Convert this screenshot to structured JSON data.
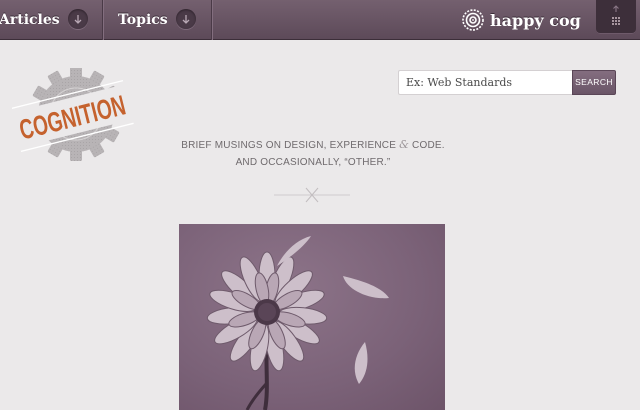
{
  "nav": {
    "items": [
      {
        "label": "Articles",
        "icon": "chevron-down-icon"
      },
      {
        "label": "Topics",
        "icon": "chevron-down-icon"
      }
    ],
    "brand": {
      "name": "happy cog",
      "icon": "happy-cog-spiral-icon"
    },
    "grid_icon": "grid-menu-icon"
  },
  "logo": {
    "text": "COGNITION"
  },
  "search": {
    "placeholder": "Ex: Web Standards",
    "button_label": "SEARCH"
  },
  "tagline": {
    "line1_before": "BRIEF MUSINGS ON DESIGN, EXPERIENCE ",
    "amp": "&",
    "line1_after": " CODE.",
    "line2": "AND OCCASIONALLY, “OTHER.”"
  },
  "feature": {
    "subject": "flower-illustration"
  },
  "colors": {
    "nav_bg": "#66525f",
    "accent": "#6a5567",
    "logo_orange": "#c5622e",
    "page_bg": "#ebe9ea",
    "feature_bg": "#7b6278"
  }
}
